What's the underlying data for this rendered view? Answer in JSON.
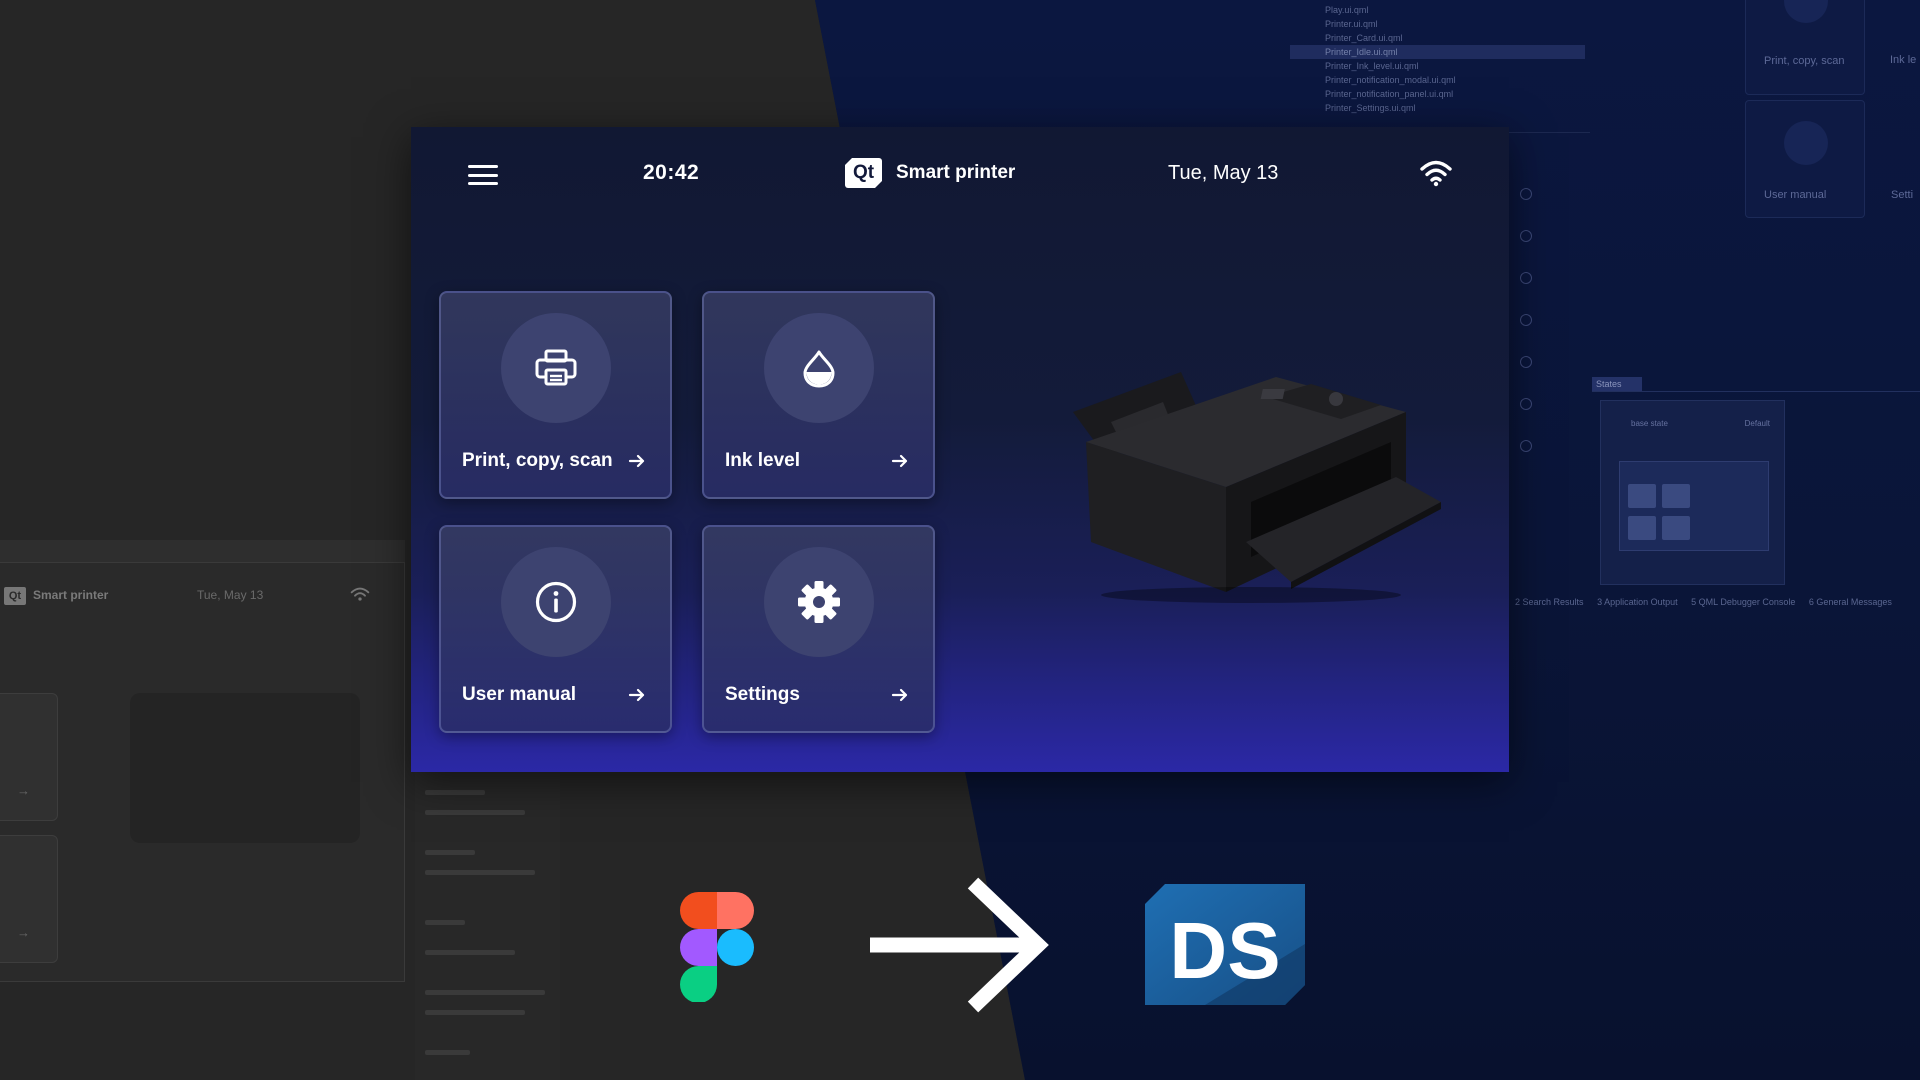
{
  "device": {
    "time": "20:42",
    "brand_logo_text": "Qt",
    "app_title": "Smart printer",
    "date": "Tue, May 13",
    "cards": [
      {
        "label": "Print, copy, scan",
        "icon": "printer-icon"
      },
      {
        "label": "Ink level",
        "icon": "ink-drop-icon"
      },
      {
        "label": "User manual",
        "icon": "info-icon"
      },
      {
        "label": "Settings",
        "icon": "gear-icon"
      }
    ]
  },
  "background_left": {
    "logo_text": "Qt",
    "app_title": "Smart printer",
    "date": "Tue, May 13"
  },
  "background_right": {
    "files": [
      "Play.ui.qml",
      "Printer.ui.qml",
      "Printer_Card.ui.qml",
      "Printer_Idle.ui.qml",
      "Printer_Ink_level.ui.qml",
      "Printer_notification_modal.ui.qml",
      "Printer_notification_panel.ui.qml",
      "Printer_Settings.ui.qml"
    ],
    "selected_file_index": 3,
    "ghost_card_print": "Print, copy, scan",
    "ghost_card_ink": "Ink le",
    "ghost_card_manual": "User manual",
    "ghost_card_settings": "Setti",
    "states_tab": "States",
    "states_base": "base state",
    "states_default": "Default",
    "output_tabs": [
      "2 Search Results",
      "3 Application Output",
      "5 QML Debugger Console",
      "6 General Messages"
    ]
  },
  "workflow": {
    "from_logo": "figma-logo",
    "to_logo_text": "DS",
    "colors": {
      "figma_red": "#f24e1e",
      "figma_orange": "#ff7262",
      "figma_purple": "#a259ff",
      "figma_blue": "#1abcfe",
      "figma_green": "#0acf83",
      "ds_blue": "#1f6fb3"
    }
  },
  "colors": {
    "dark_panel": "#262626",
    "navy_bg": "#0a1436",
    "device_top": "#111833",
    "device_bottom": "#2b28a6"
  }
}
